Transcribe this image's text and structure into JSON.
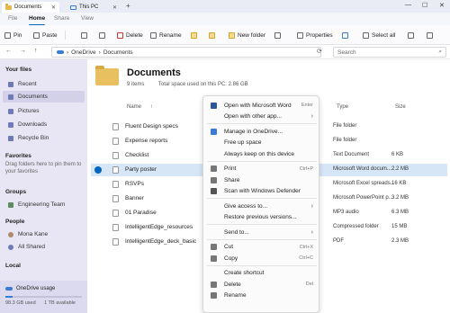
{
  "window": {
    "tabs": [
      {
        "label": "Documents",
        "close": "✕"
      },
      {
        "label": "This PC",
        "close": "✕"
      }
    ],
    "new_tab": "+",
    "controls": {
      "minimize": "—",
      "maximize": "☐",
      "close": "✕"
    }
  },
  "ribbon_tabs": [
    "File",
    "Home",
    "Share",
    "View"
  ],
  "toolbar": {
    "pin": "Pin",
    "paste": "Paste",
    "delete": "Delete",
    "rename": "Rename",
    "new_folder": "New folder",
    "properties": "Properties",
    "select_all": "Select all"
  },
  "address": {
    "back": "←",
    "forward": "→",
    "up": "↑",
    "path": [
      "OneDrive",
      "Documents"
    ],
    "separator": "›",
    "refresh": "⟳",
    "search_placeholder": "Search",
    "search_icon": "⌕"
  },
  "sidebar": {
    "your_files_header": "Your files",
    "items": [
      {
        "label": "Recent",
        "icon": "clock-icon"
      },
      {
        "label": "Documents",
        "icon": "document-icon",
        "selected": true
      },
      {
        "label": "Pictures",
        "icon": "pictures-icon"
      },
      {
        "label": "Downloads",
        "icon": "download-icon"
      },
      {
        "label": "Recycle Bin",
        "icon": "recycle-bin-icon"
      }
    ],
    "favorites_header": "Favorites",
    "favorites_hint": "Drag folders here to pin them to your favorites",
    "groups_header": "Groups",
    "groups": [
      {
        "label": "Engineering Team"
      }
    ],
    "people_header": "People",
    "people": [
      {
        "label": "Mona Kane"
      },
      {
        "label": "All Shared"
      }
    ],
    "local_header": "Local",
    "usage": {
      "label": "OneDrive usage",
      "used": "98.3 GB used",
      "available": "1 TB available",
      "fraction": 0.0983
    }
  },
  "content": {
    "title": "Documents",
    "item_count": "9 items",
    "space_used": "Total space used on this PC: 2.86 GB",
    "columns": {
      "name": "Name",
      "type": "Type",
      "size": "Size",
      "sort": "↑"
    },
    "files": [
      {
        "name": "Fluent Design specs",
        "type": "File folder",
        "size": ""
      },
      {
        "name": "Expense reports",
        "type": "File folder",
        "size": ""
      },
      {
        "name": "Checklist",
        "type": "Text Document",
        "size": "6 KB"
      },
      {
        "name": "Party poster",
        "type": "Microsoft Word docum...",
        "size": "2.2 MB",
        "selected": true
      },
      {
        "name": "RSVPs",
        "type": "Microsoft Excel spreads...",
        "size": "16 KB"
      },
      {
        "name": "Banner",
        "type": "Microsoft PowerPoint p...",
        "size": "3.2 MB"
      },
      {
        "name": "01 Paradise",
        "type": "MP3 audio",
        "size": "6.3 MB"
      },
      {
        "name": "IntelligentEdge_resources",
        "type": "Compressed folder",
        "size": "15 MB"
      },
      {
        "name": "IntelligentEdge_deck_basic",
        "type": "PDF",
        "size": "2.3 MB"
      }
    ]
  },
  "context_menu": {
    "groups": [
      [
        {
          "label": "Open with Microsoft Word",
          "shortcut": "Enter",
          "icon": "word-icon",
          "color": "#2b579a"
        },
        {
          "label": "Open with other app...",
          "submenu": "›",
          "icon": "",
          "color": ""
        }
      ],
      [
        {
          "label": "Manage in OneDrive...",
          "icon": "cloud-icon",
          "color": "#3a7bd5"
        },
        {
          "label": "Free up space",
          "icon": "",
          "color": ""
        },
        {
          "label": "Always keep on this device",
          "icon": "",
          "color": ""
        }
      ],
      [
        {
          "label": "Print",
          "shortcut": "Ctrl+P",
          "icon": "print-icon",
          "color": "#777777"
        },
        {
          "label": "Share",
          "icon": "share-icon",
          "color": "#777777"
        },
        {
          "label": "Scan with Windows Defender",
          "icon": "shield-icon",
          "color": "#555555"
        }
      ],
      [
        {
          "label": "Give access to...",
          "submenu": "›",
          "icon": "",
          "color": ""
        },
        {
          "label": "Restore previous versions...",
          "icon": "",
          "color": ""
        }
      ],
      [
        {
          "label": "Send to...",
          "submenu": "›",
          "icon": "",
          "color": ""
        }
      ],
      [
        {
          "label": "Cut",
          "shortcut": "Ctrl+X",
          "icon": "cut-icon",
          "color": "#777777"
        },
        {
          "label": "Copy",
          "shortcut": "Ctrl+C",
          "icon": "copy-icon",
          "color": "#777777"
        }
      ],
      [
        {
          "label": "Create shortcut",
          "icon": "",
          "color": ""
        },
        {
          "label": "Delete",
          "shortcut": "Del",
          "icon": "delete-icon",
          "color": "#777777"
        },
        {
          "label": "Rename",
          "icon": "rename-icon",
          "color": "#777777"
        }
      ]
    ]
  },
  "colors": {
    "accent": "#0067c0",
    "sidebar_bg": "#e8e6f4",
    "selected_row": "#d6e6f7"
  }
}
